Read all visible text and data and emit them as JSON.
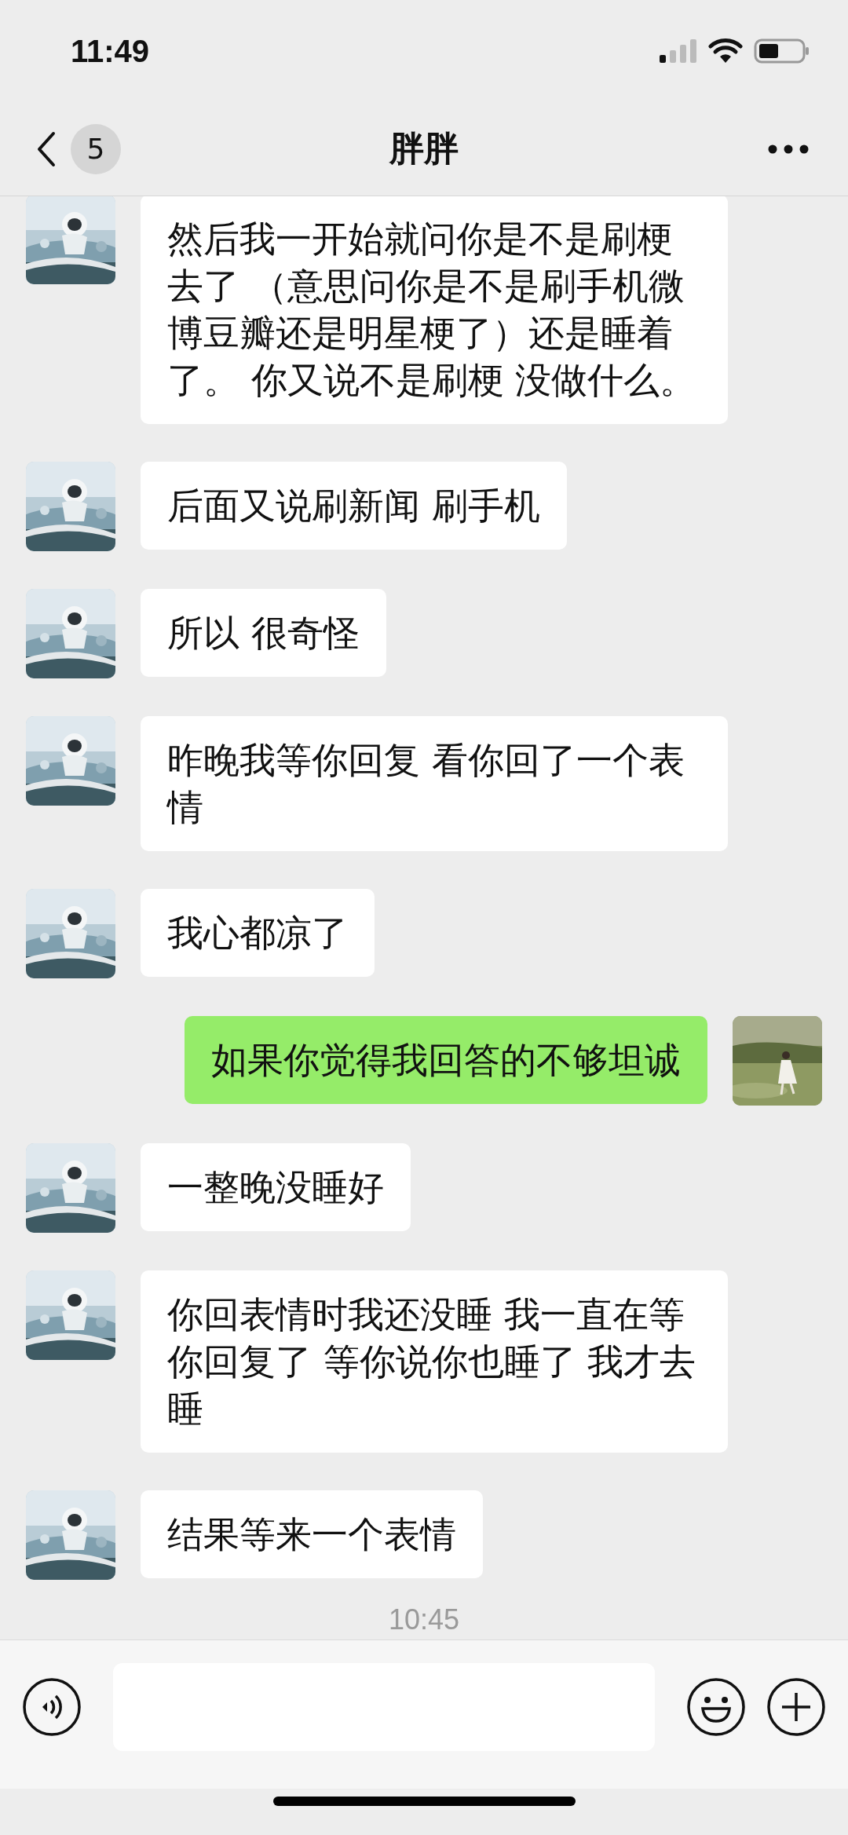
{
  "status_bar": {
    "time": "11:49"
  },
  "header": {
    "unread_count": "5",
    "title": "胖胖"
  },
  "messages": [
    {
      "kind": "received",
      "text": "然后我一开始就问你是不是刷梗去了 （意思问你是不是刷手机微博豆瓣还是明星梗了）还是睡着了。 你又说不是刷梗 没做什么。"
    },
    {
      "kind": "received",
      "text": "后面又说刷新闻 刷手机"
    },
    {
      "kind": "received",
      "text": "所以 很奇怪"
    },
    {
      "kind": "received",
      "text": "昨晚我等你回复 看你回了一个表情"
    },
    {
      "kind": "received",
      "text": "我心都凉了"
    },
    {
      "kind": "sent",
      "text": "如果你觉得我回答的不够坦诚"
    },
    {
      "kind": "received",
      "text": "一整晚没睡好"
    },
    {
      "kind": "received",
      "text": "你回表情时我还没睡 我一直在等你回复了 等你说你也睡了 我才去睡"
    },
    {
      "kind": "received",
      "text": "结果等来一个表情"
    }
  ],
  "timestamp": "10:45"
}
